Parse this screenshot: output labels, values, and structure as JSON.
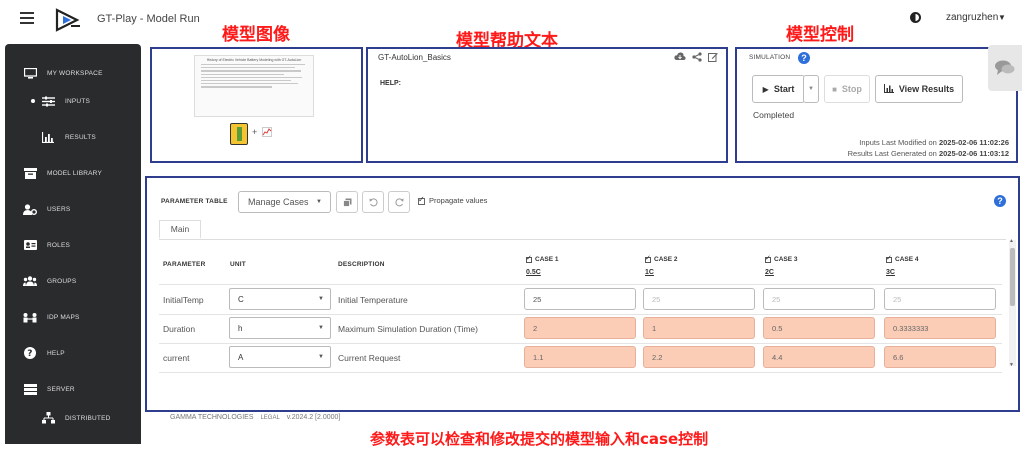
{
  "app": {
    "title": "GT-Play - Model Run",
    "user": "zangruzhen"
  },
  "annotations": {
    "model_image": "模型图像",
    "model_help": "模型帮助文本",
    "model_control": "模型控制",
    "param_table": "参数表可以检查和修改提交的模型输入和case控制"
  },
  "sidebar": {
    "items": [
      {
        "label": "MY WORKSPACE",
        "icon": "monitor-icon"
      },
      {
        "label": "INPUTS",
        "icon": "sliders-icon",
        "active": true
      },
      {
        "label": "RESULTS",
        "icon": "bar-chart-icon"
      },
      {
        "label": "MODEL LIBRARY",
        "icon": "library-icon"
      },
      {
        "label": "USERS",
        "icon": "users-gear-icon"
      },
      {
        "label": "ROLES",
        "icon": "id-card-icon"
      },
      {
        "label": "GROUPS",
        "icon": "group-icon"
      },
      {
        "label": "IDP MAPS",
        "icon": "idp-map-icon"
      },
      {
        "label": "HELP",
        "icon": "help-icon"
      },
      {
        "label": "SERVER",
        "icon": "server-icon"
      },
      {
        "label": "DISTRIBUTED",
        "icon": "network-icon"
      }
    ]
  },
  "model_image": {
    "doc_title": "History of Electric Vehicle Battery Modeling with GT-AutoLion"
  },
  "help": {
    "title": "GT-AutoLion_Basics",
    "label": "HELP:"
  },
  "simulation": {
    "label": "SIMULATION",
    "start": "Start",
    "stop": "Stop",
    "view_results": "View Results",
    "status": "Completed",
    "inputs_prefix": "Inputs Last Modified on",
    "inputs_date": "2025-02-06 11:02:26",
    "results_prefix": "Results Last Generated on",
    "results_date": "2025-02-06 11:03:12"
  },
  "param_table": {
    "label": "PARAMETER TABLE",
    "manage_cases": "Manage Cases",
    "propagate": "Propagate values",
    "tab": "Main",
    "headers": {
      "parameter": "PARAMETER",
      "unit": "UNIT",
      "description": "DESCRIPTION"
    },
    "cases": [
      {
        "name": "CASE 1",
        "sub": "0.5C"
      },
      {
        "name": "CASE 2",
        "sub": "1C"
      },
      {
        "name": "CASE 3",
        "sub": "2C"
      },
      {
        "name": "CASE 4",
        "sub": "3C"
      }
    ],
    "rows": [
      {
        "param": "InitialTemp",
        "unit": "C",
        "desc": "Initial Temperature",
        "values": [
          "25",
          "25",
          "25",
          "25"
        ],
        "state": [
          "active",
          "dim",
          "dim",
          "dim"
        ]
      },
      {
        "param": "Duration",
        "unit": "h",
        "desc": "Maximum Simulation Duration (Time)",
        "values": [
          "2",
          "1",
          "0.5",
          "0.3333333"
        ],
        "state": [
          "mod",
          "mod",
          "mod",
          "mod"
        ]
      },
      {
        "param": "current",
        "unit": "A",
        "desc": "Current Request",
        "values": [
          "1.1",
          "2.2",
          "4.4",
          "6.6"
        ],
        "state": [
          "mod",
          "mod",
          "mod",
          "mod"
        ]
      }
    ]
  },
  "footer": {
    "company": "GAMMA TECHNOLOGIES",
    "legal": "LEGAL",
    "version": "v.2024.2 [2.0000]"
  }
}
